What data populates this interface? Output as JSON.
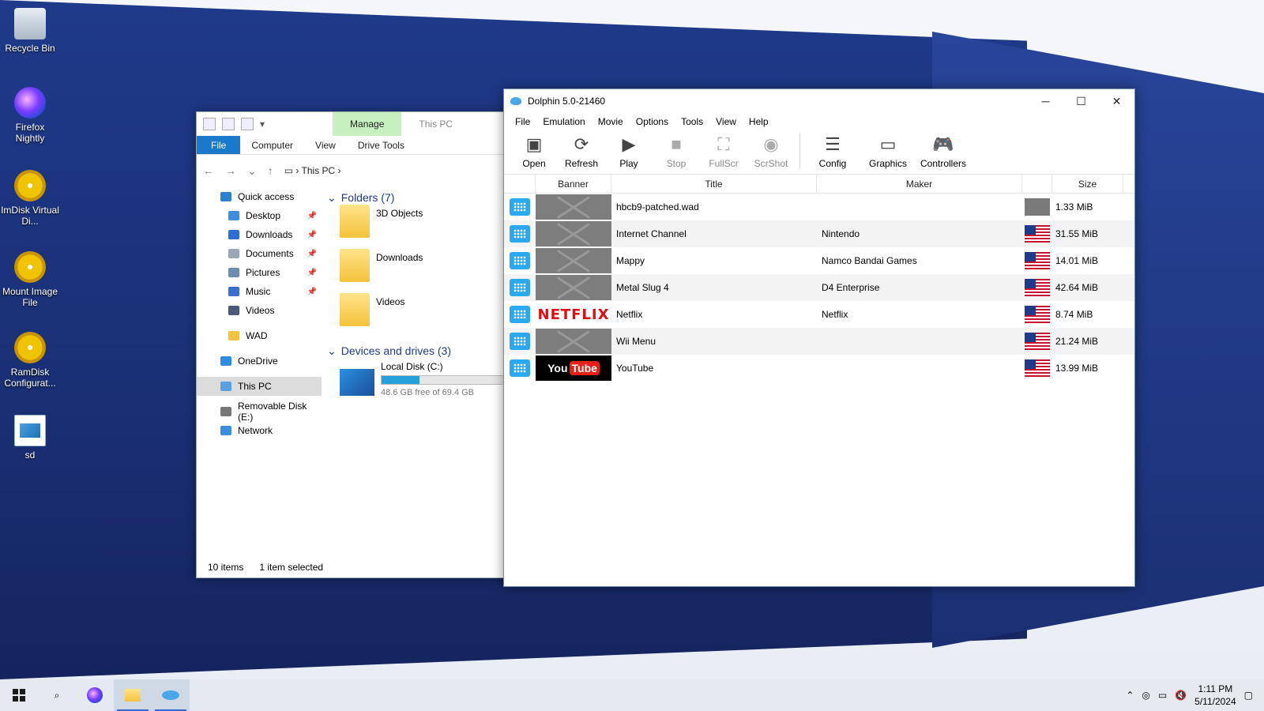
{
  "desktop": {
    "icons": [
      {
        "label": "Recycle Bin",
        "icon": "recycle-bin-icon"
      },
      {
        "label": "Firefox Nightly",
        "icon": "firefox-nightly-icon"
      },
      {
        "label": "ImDisk Virtual Di...",
        "icon": "imdisk-icon"
      },
      {
        "label": "Mount Image File",
        "icon": "mount-image-icon"
      },
      {
        "label": "RamDisk Configurat...",
        "icon": "ramdisk-icon"
      },
      {
        "label": "sd",
        "icon": "image-file-icon"
      }
    ]
  },
  "explorer": {
    "manage_tab": "Manage",
    "title": "This PC",
    "tabs": [
      "File",
      "Computer",
      "View",
      "Drive Tools"
    ],
    "address": "This PC",
    "nav": [
      {
        "label": "Quick access",
        "icon": "star-icon",
        "color": "#2d7fd2"
      },
      {
        "label": "Desktop",
        "icon": "desktop-icon",
        "color": "#3a8de0",
        "pinned": true
      },
      {
        "label": "Downloads",
        "icon": "download-icon",
        "color": "#2d6fd2",
        "pinned": true
      },
      {
        "label": "Documents",
        "icon": "document-icon",
        "color": "#9aa7b8",
        "pinned": true
      },
      {
        "label": "Pictures",
        "icon": "pictures-icon",
        "color": "#6c8db0",
        "pinned": true
      },
      {
        "label": "Music",
        "icon": "music-icon",
        "color": "#3a6fd2",
        "pinned": true
      },
      {
        "label": "Videos",
        "icon": "videos-icon",
        "color": "#4a5a7a"
      },
      {
        "label": "WAD",
        "icon": "folder-icon",
        "color": "#f4c23c"
      },
      {
        "label": "OneDrive",
        "icon": "cloud-icon",
        "color": "#2d8ce6"
      },
      {
        "label": "This PC",
        "icon": "pc-icon",
        "color": "#5aa0e0"
      },
      {
        "label": "Removable Disk (E:)",
        "icon": "usb-drive-icon",
        "color": "#777777"
      },
      {
        "label": "Network",
        "icon": "network-icon",
        "color": "#3a8de0"
      }
    ],
    "folders_header": "Folders (7)",
    "folders": [
      "3D Objects",
      "Downloads",
      "Videos"
    ],
    "devices_header": "Devices and drives (3)",
    "drive": {
      "name": "Local Disk (C:)",
      "free": "48.6 GB free of 69.4 GB",
      "used_fraction": 0.3
    },
    "status_items": "10 items",
    "status_selected": "1 item selected"
  },
  "dolphin": {
    "title": "Dolphin 5.0-21460",
    "menu": [
      "File",
      "Emulation",
      "Movie",
      "Options",
      "Tools",
      "View",
      "Help"
    ],
    "toolbar": [
      {
        "label": "Open",
        "icon": "open-disc-icon",
        "glyph": "▣",
        "enabled": true
      },
      {
        "label": "Refresh",
        "icon": "refresh-icon",
        "glyph": "⟳",
        "enabled": true
      },
      {
        "label": "Play",
        "icon": "play-icon",
        "glyph": "▶",
        "enabled": true
      },
      {
        "label": "Stop",
        "icon": "stop-icon",
        "glyph": "■",
        "enabled": false
      },
      {
        "label": "FullScr",
        "icon": "fullscreen-icon",
        "glyph": "⛶",
        "enabled": false
      },
      {
        "label": "ScrShot",
        "icon": "screenshot-icon",
        "glyph": "◉",
        "enabled": false
      },
      {
        "label": "Config",
        "icon": "config-sliders-icon",
        "glyph": "☰",
        "enabled": true
      },
      {
        "label": "Graphics",
        "icon": "monitor-icon",
        "glyph": "▭",
        "enabled": true
      },
      {
        "label": "Controllers",
        "icon": "gamepad-icon",
        "glyph": "🎮",
        "enabled": true
      }
    ],
    "columns": {
      "banner": "Banner",
      "title": "Title",
      "maker": "Maker",
      "size": "Size"
    },
    "games": [
      {
        "title": "hbcb9-patched.wad",
        "maker": "",
        "size": "1.33 MiB",
        "banner": "none",
        "region": "unknown"
      },
      {
        "title": "Internet Channel",
        "maker": "Nintendo",
        "size": "31.55 MiB",
        "banner": "none",
        "region": "usa"
      },
      {
        "title": "Mappy",
        "maker": "Namco Bandai Games",
        "size": "14.01 MiB",
        "banner": "none",
        "region": "usa"
      },
      {
        "title": "Metal Slug 4",
        "maker": "D4 Enterprise",
        "size": "42.64 MiB",
        "banner": "none",
        "region": "usa"
      },
      {
        "title": "Netflix",
        "maker": "Netflix",
        "size": "8.74 MiB",
        "banner": "netflix",
        "banner_text": "NETFLIX",
        "region": "usa"
      },
      {
        "title": "Wii Menu",
        "maker": "",
        "size": "21.24 MiB",
        "banner": "none",
        "region": "usa"
      },
      {
        "title": "YouTube",
        "maker": "",
        "size": "13.99 MiB",
        "banner": "youtube",
        "banner_text_a": "You",
        "banner_text_b": "Tube",
        "region": "usa"
      }
    ]
  },
  "taskbar": {
    "time": "1:11 PM",
    "date": "5/11/2024"
  }
}
